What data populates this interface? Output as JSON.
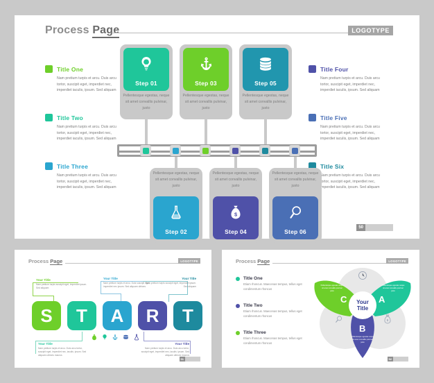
{
  "slide1": {
    "header": {
      "title_light": "Process ",
      "title_bold": "Page",
      "logotype": "LOGOTYPE"
    },
    "page_number": "50",
    "left_legend": [
      {
        "label": "Title One",
        "color": "#6ecf2a",
        "body": "Nam pretium turpis et arcu. Duis arcu tortor, suscipit eget, imperdiet nec, imperdiet iaculis, ipsum. Sed aliquam"
      },
      {
        "label": "Title Two",
        "color": "#1fc69a",
        "body": "Nam pretium turpis et arcu. Duis arcu tortor, suscipit eget, imperdiet nec, imperdiet iaculis, ipsum. Sed aliquam"
      },
      {
        "label": "Title Three",
        "color": "#2aa5cf",
        "body": "Nam pretium turpis et arcu. Duis arcu tortor, suscipit eget, imperdiet nec, imperdiet iaculis, ipsum. Sed aliquam"
      }
    ],
    "right_legend": [
      {
        "label": "Title Four",
        "color": "#4f51a8",
        "body": "Nam pretium turpis et arcu. Duis arcu tortor, suscipit eget, imperdiet nec, imperdiet iaculis, ipsum. Sed aliquam"
      },
      {
        "label": "Title Five",
        "color": "#4a6fb5",
        "body": "Nam pretium turpis et arcu. Duis arcu tortor, suscipit eget, imperdiet nec, imperdiet iaculis, ipsum. Sed aliquam"
      },
      {
        "label": "Title Six",
        "color": "#1e8a9e",
        "body": "Nam pretium turpis et arcu. Duis arcu tortor, suscipit eget, imperdiet nec, imperdiet iaculis, ipsum. Sed aliquam"
      }
    ],
    "cards": [
      {
        "step": "Step 01",
        "icon": "lightbulb-icon",
        "color": "#1fc69a",
        "body": "Pellentesque egestas, neque sit amet convallis pulvinar, justo"
      },
      {
        "step": "Step 03",
        "icon": "anchor-icon",
        "color": "#6ecf2a",
        "body": "Pellentesque egestas, neque sit amet convallis pulvinar, justo"
      },
      {
        "step": "Step 05",
        "icon": "database-icon",
        "color": "#2196ae",
        "body": "Pellentesque egestas, neque sit amet convallis pulvinar, justo"
      },
      {
        "step": "Step 02",
        "icon": "flask-icon",
        "color": "#2aa5cf",
        "body": "Pellentesque egestas, neque sit amet convallis pulvinar, justo"
      },
      {
        "step": "Step 04",
        "icon": "moneybag-icon",
        "color": "#4f51a8",
        "body": "Pellentesque egestas, neque sit amet convallis pulvinar, justo"
      },
      {
        "step": "Step 06",
        "icon": "magnifier-icon",
        "color": "#4a6fb5",
        "body": "Pellentesque egestas, neque sit amet convallis pulvinar, justo"
      }
    ],
    "chain_nodes": [
      "#1fc69a",
      "#2aa5cf",
      "#6ecf2a",
      "#4f51a8",
      "#1e8a9e",
      "#4a6fb5"
    ]
  },
  "slide2": {
    "header": {
      "title_light": "Process ",
      "title_bold": "Page",
      "logotype": "LOGOTYPE"
    },
    "page_number": "51",
    "letters": [
      {
        "char": "S",
        "color": "#6ecf2a"
      },
      {
        "char": "T",
        "color": "#1fc69a"
      },
      {
        "char": "A",
        "color": "#2aa5cf"
      },
      {
        "char": "R",
        "color": "#4f51a8"
      },
      {
        "char": "T",
        "color": "#1e8a9e"
      }
    ],
    "callouts": [
      {
        "title": "Your Title",
        "body": "Nam pretium turpis suscipit eget, imperdiet ipsum. Sed aliquam",
        "color": "#6ecf2a"
      },
      {
        "title": "Your Title",
        "body": "Nam pretium turpis et arcu. Duis suscipit eget, imperdiet nec ipsum. Sed aliquam ultrices",
        "color": "#2aa5cf"
      },
      {
        "title": "Your Title",
        "body": "Nam pretium turpis suscipit eget, imperdiet ipsum. Sed aliquam",
        "color": "#1e8a9e"
      },
      {
        "title": "Your Title",
        "body": "Nam pretium turpis et arcu. Duis arcu tortor, suscipit eget, imperdiet nec, iaculis. ipsum. Sed aliquam ultrices macros",
        "color": "#1fc69a"
      },
      {
        "title": "Your Title",
        "body": "Nam pretium turpis et arcu. Duis arcu tortor, suscipit eget, imperdiet nec, iaculis. ipsum. Sed aliquam ultrices macros",
        "color": "#4f51a8"
      }
    ],
    "mini_icons": [
      {
        "icon": "moneybag-icon",
        "color": "#6ecf2a"
      },
      {
        "icon": "lightbulb-icon",
        "color": "#1fc69a"
      },
      {
        "icon": "anchor-icon",
        "color": "#2aa5cf"
      },
      {
        "icon": "database-icon",
        "color": "#4a6fb5"
      },
      {
        "icon": "flask-icon",
        "color": "#4f51a8"
      }
    ]
  },
  "slide3": {
    "header": {
      "title_light": "Process ",
      "title_bold": "Page",
      "logotype": "LOGOTYPE"
    },
    "page_number": "52",
    "legend": [
      {
        "label": "Title One",
        "color": "#1fc69a",
        "body": "Etiam rhoncus. Maecenas tempus, tellus eget condimentum rhoncus"
      },
      {
        "label": "Title Two",
        "color": "#4f51a8",
        "body": "Etiam rhoncus. Maecenas tempus, tellus eget condimentum rhoncus"
      },
      {
        "label": "Title Three",
        "color": "#6ecf2a",
        "body": "Etiam rhoncus. Maecenas tempus, tellus eget condimentum rhoncus"
      }
    ],
    "center_line1": "Your",
    "center_line2": "Title",
    "petals": [
      {
        "letter": "C",
        "color": "#6ecf2a",
        "body": "Pellentesque egestas neque sit amet convallis pulvinar justo"
      },
      {
        "letter": "A",
        "color": "#1fc69a",
        "body": "Pellentesque egestas neque sit amet convallis pulvinar justo"
      },
      {
        "letter": "B",
        "color": "#4f51a8",
        "body": "Pellentesque egestas neque sit amet convallis pulvinar justo"
      }
    ],
    "venn_icons": [
      {
        "icon": "clock-icon",
        "color": "#9aa4b5"
      },
      {
        "icon": "magnifier-icon",
        "color": "#9aa4b5"
      },
      {
        "icon": "moneybag-icon",
        "color": "#9aa4b5"
      }
    ]
  }
}
